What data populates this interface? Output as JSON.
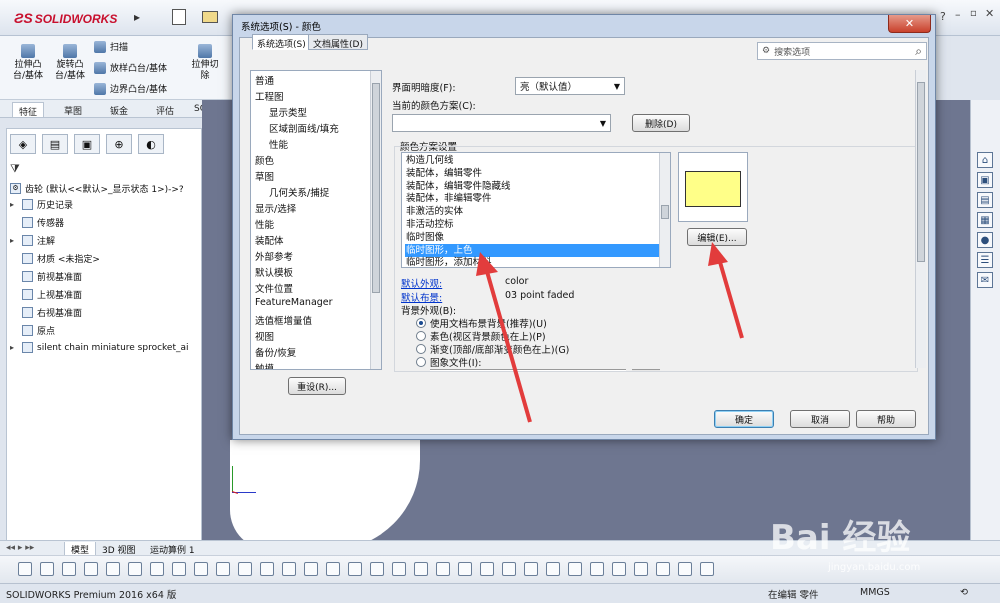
{
  "app": {
    "logo_text": "SOLIDWORKS"
  },
  "ribbon": {
    "buttons": [
      {
        "label": "拉伸凸\n台/基体"
      },
      {
        "label": "旋转凸\n台/基体"
      },
      {
        "label": "扫描"
      },
      {
        "label": "放样凸台/基体"
      },
      {
        "label": "边界凸台/基体"
      },
      {
        "label": "拉伸切\n除"
      }
    ],
    "tabs": [
      "特征",
      "草图",
      "钣金",
      "评估",
      "SOLIDW"
    ]
  },
  "feature_tree": {
    "root": "齿轮 (默认<<默认>_显示状态 1>)->?",
    "items": [
      {
        "label": "历史记录",
        "expand": "▸"
      },
      {
        "label": "传感器",
        "expand": ""
      },
      {
        "label": "注解",
        "expand": "▸"
      },
      {
        "label": "材质 <未指定>",
        "expand": ""
      },
      {
        "label": "前视基准面",
        "expand": ""
      },
      {
        "label": "上视基准面",
        "expand": ""
      },
      {
        "label": "右视基准面",
        "expand": ""
      },
      {
        "label": "原点",
        "expand": ""
      },
      {
        "label": "silent chain miniature sprocket_ai",
        "expand": "▸"
      }
    ]
  },
  "dialog": {
    "title": "系统选项(S) - 颜色",
    "tabs": [
      "系统选项(S)",
      "文档属性(D)"
    ],
    "search_placeholder": "搜索选项",
    "categories": [
      {
        "label": "普通",
        "indent": 0
      },
      {
        "label": "工程图",
        "indent": 0
      },
      {
        "label": "显示类型",
        "indent": 2
      },
      {
        "label": "区域剖面线/填充",
        "indent": 2
      },
      {
        "label": "性能",
        "indent": 2
      },
      {
        "label": "颜色",
        "indent": 0
      },
      {
        "label": "草图",
        "indent": 0
      },
      {
        "label": "几何关系/捕捉",
        "indent": 2
      },
      {
        "label": "显示/选择",
        "indent": 0
      },
      {
        "label": "性能",
        "indent": 0
      },
      {
        "label": "装配体",
        "indent": 0
      },
      {
        "label": "外部参考",
        "indent": 0
      },
      {
        "label": "默认模板",
        "indent": 0
      },
      {
        "label": "文件位置",
        "indent": 0
      },
      {
        "label": "FeatureManager",
        "indent": 0
      },
      {
        "label": "选值框增量值",
        "indent": 0
      },
      {
        "label": "视图",
        "indent": 0
      },
      {
        "label": "备份/恢复",
        "indent": 0
      },
      {
        "label": "触摸",
        "indent": 0
      }
    ],
    "reset_button": "重设(R)...",
    "brightness_label": "界面明暗度(F):",
    "brightness_value": "亮（默认值）",
    "current_scheme_label": "当前的颜色方案(C):",
    "current_scheme_value": "",
    "delete_button": "删除(D)",
    "scheme_settings_label": "颜色方案设置",
    "scheme_items": [
      {
        "label": "构造几何线",
        "selected": false
      },
      {
        "label": "装配体，编辑零件",
        "selected": false
      },
      {
        "label": "装配体，编辑零件隐藏线",
        "selected": false
      },
      {
        "label": "装配体，非编辑零件",
        "selected": false
      },
      {
        "label": "非激活的实体",
        "selected": false
      },
      {
        "label": "非活动控标",
        "selected": false
      },
      {
        "label": "临时图像",
        "selected": false
      },
      {
        "label": "临时图形，上色",
        "selected": true
      },
      {
        "label": "临时图形，添加材料",
        "selected": false
      }
    ],
    "preview_color": "#ffff88",
    "edit_button": "编辑(E)...",
    "default_appearance_label": "默认外观:",
    "default_appearance_value": "color",
    "default_scene_label": "默认布景:",
    "default_scene_value": "03 point faded",
    "background_label": "背景外观(B):",
    "background_options": [
      {
        "label": "使用文档布景背景(推荐)(U)",
        "checked": true
      },
      {
        "label": "素色(视区背景颜色在上)(P)",
        "checked": false
      },
      {
        "label": "渐变(顶部/底部渐变颜色在上)(G)",
        "checked": false
      },
      {
        "label": "图象文件(I):",
        "checked": false
      }
    ],
    "ok_button": "确定",
    "cancel_button": "取消",
    "help_button": "帮助"
  },
  "model_tabs": [
    "模型",
    "3D 视图",
    "运动算例 1"
  ],
  "status_bar": {
    "product": "SOLIDWORKS Premium 2016 x64 版",
    "mode": "在编辑 零件",
    "units": "MMGS"
  },
  "watermark": {
    "brand": "Bai 经验",
    "url": "jingyan.baidu.com"
  },
  "colors": {
    "selection": "#3399ff",
    "annotation_arrow": "#e23c3c",
    "graphics_bg": "#6e7690"
  }
}
